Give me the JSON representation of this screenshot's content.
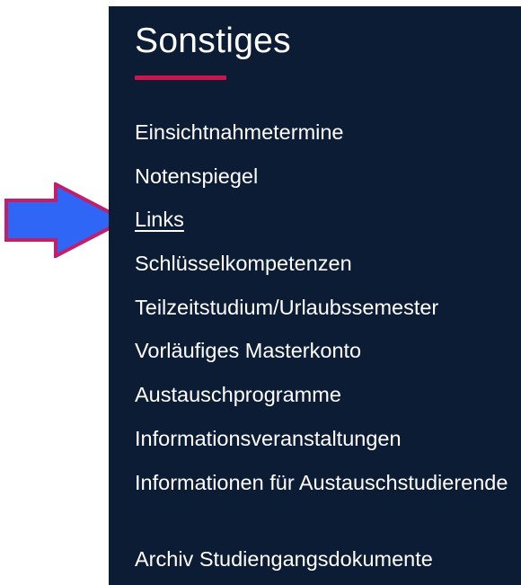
{
  "section": {
    "title": "Sonstiges"
  },
  "colors": {
    "panel_background": "#0c1c35",
    "accent_underline": "#c8174f",
    "link_text": "#ffffff",
    "arrow_fill": "#2f66f6",
    "arrow_stroke": "#c21e6a"
  },
  "nav": {
    "items": [
      {
        "label": "Einsichtnahmetermine"
      },
      {
        "label": "Notenspiegel"
      },
      {
        "label": "Links",
        "active": true
      },
      {
        "label": "Schlüsselkompetenzen"
      },
      {
        "label": "Teilzeitstudium/Urlaubssemester"
      },
      {
        "label": "Vorläufiges Masterkonto"
      },
      {
        "label": "Austauschprogramme"
      },
      {
        "label": "Informationsveranstaltungen"
      },
      {
        "label": "Informationen für Austauschstudierende"
      },
      {
        "label": "Archiv Studiengangsdokumente"
      }
    ]
  },
  "annotation": {
    "icon": "right-arrow-icon",
    "points_to": "Links"
  }
}
